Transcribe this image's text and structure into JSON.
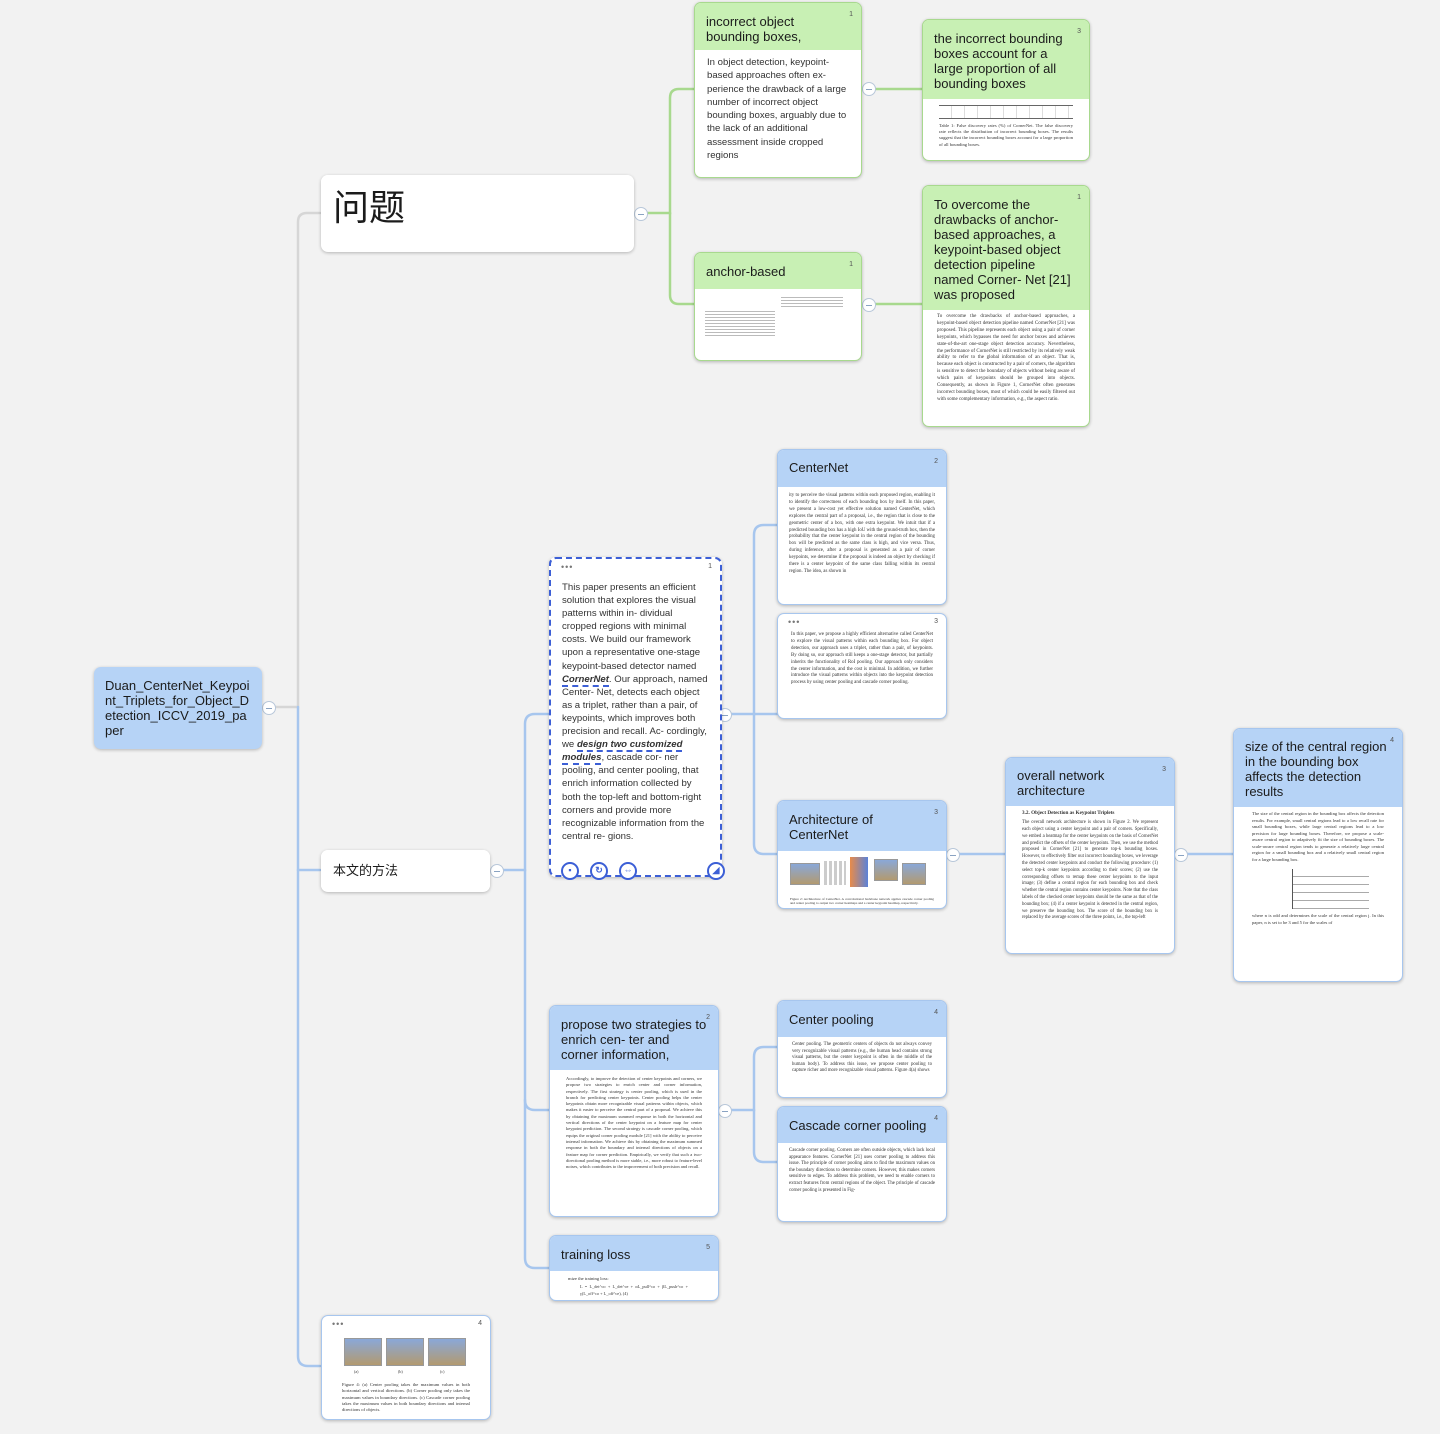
{
  "root": {
    "title": "Duan_CenterNet_Keypoint_Triplets_for_Object_Detection_ICCV_2019_paper"
  },
  "problem": {
    "title": "问题",
    "children": {
      "incorrect": {
        "title": "incorrect object bounding boxes,",
        "page": "1",
        "note": "In object detection, keypoint-based approaches often ex- perience the drawback of a large number of incorrect object bounding boxes, arguably due to the lack of an additional assessment inside cropped regions"
      },
      "incorrect_child": {
        "title": "the incorrect bounding boxes account for a large proportion of all bounding boxes",
        "page": "3",
        "caption": "Table 1: False discovery rates (%) of CornerNet. The false discovery rate reflects the distribution of incorrect bounding boxes. The results suggest that the incorrect bounding boxes account for a large proportion of all bounding boxes."
      },
      "anchor": {
        "title": "anchor-based",
        "page": "1"
      },
      "anchor_child": {
        "title": "To overcome the drawbacks of anchor-based approaches, a keypoint-based object detection pipeline named Corner- Net [21] was proposed",
        "page": "1",
        "excerpt": "To overcome the drawbacks of anchor-based approaches, a keypoint-based object detection pipeline named CornerNet [21] was proposed. This pipeline represents each object using a pair of corner keypoints, which bypasses the need for anchor boxes and achieves state-of-the-art one-stage object detection accuracy. Nevertheless, the performance of CornerNet is still restricted by its relatively weak ability to refer to the global information of an object. That is, because each object is constructed by a pair of corners, the algorithm is sensitive to detect the boundary of objects without being aware of which pairs of keypoints should be grouped into objects. Consequently, as shown in Figure 1, CornerNet often generates incorrect bounding boxes, most of which could be easily filtered out with some complementary information, e.g., the aspect ratio."
      }
    }
  },
  "method": {
    "title": "本文的方法",
    "selected": {
      "page": "1",
      "text_a": "This paper presents an efficient solution that explores the visual patterns within in- dividual cropped regions with minimal costs. We build our framework upon a representative one-stage keypoint-based detector named ",
      "em1": "CornerNet",
      "text_b": ". Our approach, named Center- Net, detects each object as a triplet, rather than a pair, of keypoints, which improves both precision and recall. Ac- cordingly, we ",
      "em2": "design two customized modules",
      "text_c": ", cascade cor- ner pooling, and center pooling, that enrich information collected by both the top-left and bottom-right corners and provide more recognizable information from the central re- gions."
    },
    "centernet": {
      "title": "CenterNet",
      "page": "2",
      "excerpt": "ity to perceive the visual patterns within each proposed region, enabling it to identify the correctness of each bounding box by itself. In this paper, we present a low-cost yet effective solution named CenterNet, which explores the central part of a proposal, i.e., the region that is close to the geometric center of a box, with one extra keypoint. We intuit that if a predicted bounding box has a high IoU with the ground-truth box, then the probability that the center keypoint in the central region of the bounding box will be predicted as the same class is high, and vice versa. Thus, during inference, after a proposal is generated as a pair of corner keypoints, we determine if the proposal is indeed an object by checking if there is a center keypoint of the same class falling within its central region. The idea, as shown in"
    },
    "centernet_note": {
      "page": "3",
      "excerpt": "In this paper, we propose a highly efficient alternative called CenterNet to explore the visual patterns within each bounding box. For object detection, our approach uses a triplet, rather than a pair, of keypoints. By doing so, our approach still keeps a one-stage detector, but partially inherits the functionality of RoI pooling. Our approach only considers the center information, and the cost is minimal. In addition, we further introduce the visual patterns within objects into the keypoint detection process by using center pooling and cascade corner pooling."
    },
    "architecture": {
      "title": "Architecture of CenterNet",
      "page": "3",
      "caption": "Figure 2: Architecture of CenterNet. A convolutional backbone network applies cascade corner pooling and center pooling to output two corner heatmaps and a center keypoint heatmap, respectively."
    },
    "overall": {
      "title": "overall network architecture",
      "page": "3",
      "heading": "3.2. Object Detection as Keypoint Triplets",
      "excerpt": "The overall network architecture is shown in Figure 2. We represent each object using a center keypoint and a pair of corners. Specifically, we embed a heatmap for the center keypoints on the basis of CornerNet and predict the offsets of the center keypoints. Then, we use the method proposed in CornerNet [21] to generate top-k bounding boxes. However, to effectively filter out incorrect bounding boxes, we leverage the detected center keypoints and conduct the following procedure: (1) select top-k center keypoints according to their scores; (2) use the corresponding offsets to remap these center keypoints to the input image; (3) define a central region for each bounding box and check whether the central region contains center keypoints. Note that the class labels of the checked center keypoints should be the same as that of the bounding box; (4) if a center keypoint is detected in the central region, we preserve the bounding box. The score of the bounding box is replaced by the average scores of the three points, i.e., the top-left"
    },
    "central_region": {
      "title": "size of the central region in the bounding box affects the detection results",
      "page": "4",
      "excerpt": "The size of the central region in the bounding box affects the detection results. For example, small central regions lead to a low recall rate for small bounding boxes, while large central regions lead to a low precision for large bounding boxes. Therefore, we propose a scale-aware central region to adaptively fit the size of bounding boxes. The scale-aware central region tends to generate a relatively large central region for a small bounding box and a relatively small central region for a large bounding box.",
      "tail": "where n is odd and determines the scale of the central region j. In this paper, n is set to be 3 and 5 for the scales of"
    },
    "strategies": {
      "title": "propose two strategies to enrich cen- ter and corner information,",
      "page": "2",
      "excerpt": "Accordingly, to improve the detection of center keypoints and corners, we propose two strategies to enrich center and corner information, respectively. The first strategy is center pooling, which is used in the branch for predicting center keypoints. Center pooling helps the center keypoints obtain more recognizable visual patterns within objects, which makes it easier to perceive the central part of a proposal. We achieve this by obtaining the maximum summed response in both the horizontal and vertical directions of the center keypoint on a feature map for center keypoint prediction. The second strategy is cascade corner pooling, which equips the original corner pooling module [21] with the ability to perceive internal information. We achieve this by obtaining the maximum summed response in both the boundary and internal directions of objects on a feature map for corner prediction. Empirically, we verify that such a two-directional pooling method is more stable, i.e., more robust to feature-level noises, which contributes to the improvement of both precision and recall."
    },
    "center_pooling": {
      "title": "Center pooling",
      "page": "4",
      "excerpt": "Center pooling. The geometric centers of objects do not always convey very recognizable visual patterns (e.g., the human head contains strong visual patterns, but the center keypoint is often in the middle of the human body). To address this issue, we propose center pooling to capture richer and more recognizable visual patterns. Figure 4(a) shows"
    },
    "cascade": {
      "title": "Cascade corner pooling",
      "page": "4",
      "excerpt": "Cascade corner pooling. Corners are often outside objects, which lack local appearance features. CornerNet [21] uses corner pooling to address this issue. The principle of corner pooling aims to find the maximum values on the boundary directions to determine corners. However, this makes corners sensitive to edges. To address this problem, we need to enable corners to extract features from central regions of the object. The principle of cascade corner pooling is presented in Fig-"
    },
    "training": {
      "title": "training loss",
      "page": "5",
      "excerpt": "mize the training loss:",
      "formula": "L = L_det^co + L_det^ce + αL_pull^co + βL_push^co + γ(L_off^co + L_off^ce),   (4)"
    }
  },
  "figure_node": {
    "page": "4",
    "labels": [
      "(a)",
      "(b)",
      "(c)"
    ],
    "caption": "Figure 4: (a) Center pooling takes the maximum values in both horizontal and vertical directions. (b) Corner pooling only takes the maximum values in boundary directions. (c) Cascade corner pooling takes the maximum values in both boundary directions and internal directions of objects."
  }
}
